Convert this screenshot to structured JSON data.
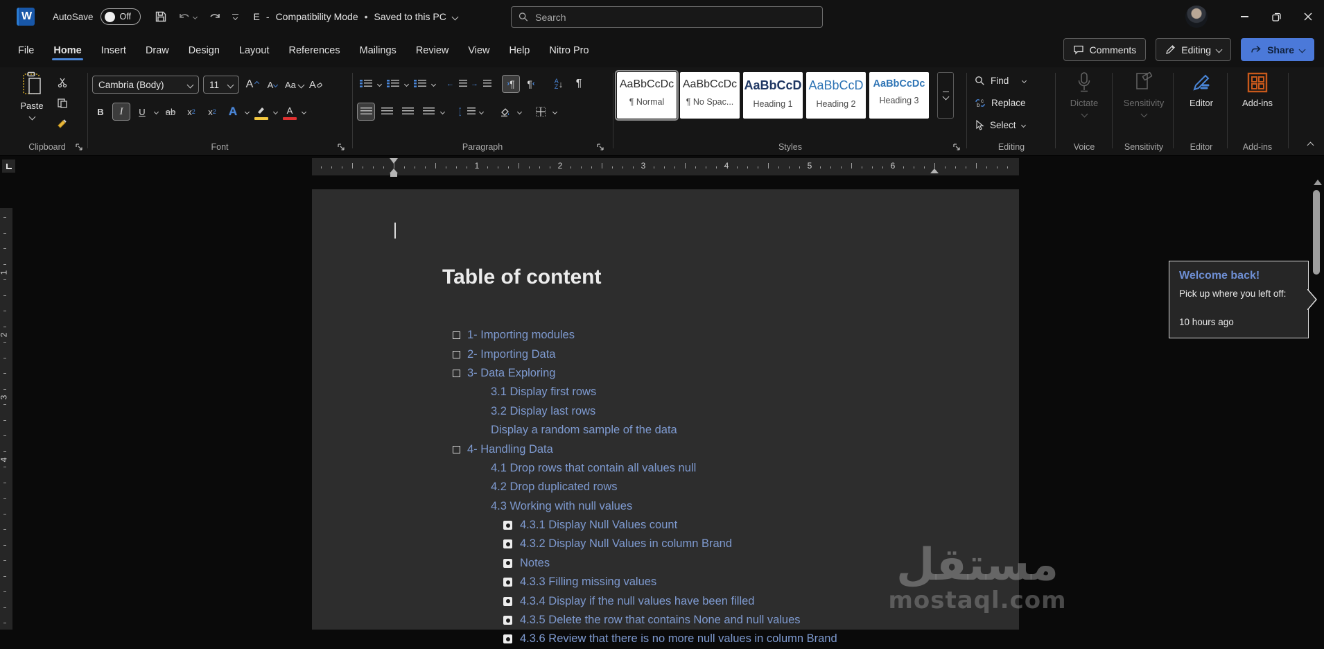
{
  "colors": {
    "accent_blue": "#4a86d8",
    "link_blue": "#7e9ad0",
    "share_blue": "#4b79d9",
    "addins_orange": "#c9591b",
    "highlight_yellow": "#f3c73f",
    "font_color_red": "#e03131",
    "page_gray": "#2d2d2d"
  },
  "titlebar": {
    "app_icon_letter": "W",
    "autosave_label": "AutoSave",
    "autosave_state": "Off",
    "doc_title": "E",
    "dash": "-",
    "mode": "Compatibility Mode",
    "dot": "•",
    "saved_status": "Saved to this PC",
    "search_placeholder": "Search"
  },
  "tabs": [
    {
      "label": "File",
      "active": false
    },
    {
      "label": "Home",
      "active": true
    },
    {
      "label": "Insert",
      "active": false
    },
    {
      "label": "Draw",
      "active": false
    },
    {
      "label": "Design",
      "active": false
    },
    {
      "label": "Layout",
      "active": false
    },
    {
      "label": "References",
      "active": false
    },
    {
      "label": "Mailings",
      "active": false
    },
    {
      "label": "Review",
      "active": false
    },
    {
      "label": "View",
      "active": false
    },
    {
      "label": "Help",
      "active": false
    },
    {
      "label": "Nitro Pro",
      "active": false
    }
  ],
  "actions": {
    "comments": "Comments",
    "editing": "Editing",
    "share": "Share"
  },
  "ribbon": {
    "clipboard": {
      "paste": "Paste",
      "label": "Clipboard"
    },
    "font": {
      "name": "Cambria (Body)",
      "size": "11",
      "label": "Font",
      "glyphs": {
        "bold": "B",
        "italic": "I",
        "underline": "U",
        "strike": "ab",
        "sub_base": "x",
        "sub_small": "2",
        "sup_base": "x",
        "sup_small": "2",
        "effects": "A",
        "grow": "A",
        "shrink": "A",
        "case": "Aa",
        "clear": "A",
        "fontcolor": "A"
      }
    },
    "paragraph": {
      "label": "Paragraph",
      "glyphs": {
        "ltr": "¶",
        "rtl": "¶",
        "sort_a": "A",
        "sort_z": "Z",
        "pilcrow": "¶"
      }
    },
    "styles": {
      "label": "Styles",
      "items": [
        {
          "preview": "AaBbCcDc",
          "name": "¶ Normal",
          "selected": true
        },
        {
          "preview": "AaBbCcDc",
          "name": "¶ No Spac...",
          "selected": false
        },
        {
          "preview": "AaBbCcD",
          "name": "Heading 1",
          "selected": false
        },
        {
          "preview": "AaBbCcD",
          "name": "Heading 2",
          "selected": false
        },
        {
          "preview": "AaBbCcDc",
          "name": "Heading 3",
          "selected": false
        }
      ]
    },
    "editing": {
      "find": "Find",
      "replace": "Replace",
      "select": "Select",
      "label": "Editing"
    },
    "voice": {
      "dictate": "Dictate",
      "label": "Voice"
    },
    "sensitivity": {
      "button": "Sensitivity",
      "label": "Sensitivity"
    },
    "editor": {
      "button": "Editor",
      "label": "Editor"
    },
    "addins": {
      "button": "Add-ins",
      "label": "Add-ins"
    }
  },
  "ruler": {
    "h_numbers": [
      "1",
      "2",
      "3",
      "4",
      "5",
      "6"
    ],
    "v_numbers": [
      "1",
      "2",
      "3",
      "4"
    ]
  },
  "document": {
    "heading": "Table of content",
    "toc": [
      {
        "text": "1- Importing modules",
        "level": 1,
        "marker": "open"
      },
      {
        "text": "2- Importing Data",
        "level": 1,
        "marker": "open"
      },
      {
        "text": "3- Data Exploring",
        "level": 1,
        "marker": "open"
      },
      {
        "text": "3.1 Display first rows",
        "level": 2,
        "marker": "none"
      },
      {
        "text": "3.2 Display last rows",
        "level": 2,
        "marker": "none"
      },
      {
        "text": "Display a random sample of the data",
        "level": 2,
        "marker": "none"
      },
      {
        "text": "4- Handling Data",
        "level": 1,
        "marker": "open"
      },
      {
        "text": "4.1 Drop rows that contain all values null",
        "level": 2,
        "marker": "none"
      },
      {
        "text": "4.2 Drop duplicated rows",
        "level": 2,
        "marker": "none"
      },
      {
        "text": "4.3 Working with null values",
        "level": 2,
        "marker": "none"
      },
      {
        "text": "4.3.1 Display Null Values count",
        "level": 3,
        "marker": "dot"
      },
      {
        "text": "4.3.2 Display Null Values in column Brand",
        "level": 3,
        "marker": "dot"
      },
      {
        "text": "Notes",
        "level": 3,
        "marker": "dot"
      },
      {
        "text": "4.3.3 Filling missing values",
        "level": 3,
        "marker": "dot"
      },
      {
        "text": "4.3.4 Display if the null values have been filled",
        "level": 3,
        "marker": "dot"
      },
      {
        "text": "4.3.5 Delete the row that contains None and null values",
        "level": 3,
        "marker": "dot"
      },
      {
        "text": "4.3.6 Review that there is no more null values in column Brand",
        "level": 3,
        "marker": "dot"
      }
    ],
    "watermark": {
      "arabic": "مستقل",
      "latin": "mostaql.com"
    }
  },
  "welcome": {
    "title": "Welcome back!",
    "subtitle": "Pick up where you left off:",
    "time": "10 hours ago"
  }
}
